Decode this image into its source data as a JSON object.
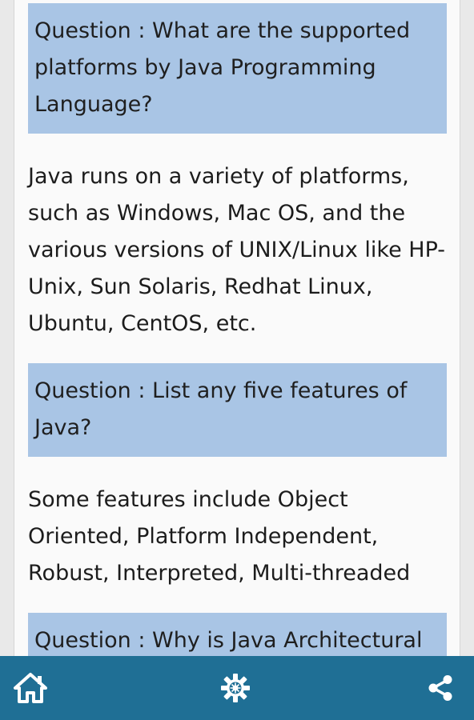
{
  "qa": [
    {
      "question": "Question : What are the supported platforms by Java Programming Language?",
      "answer": "Java runs on a variety of platforms, such as Windows, Mac OS, and the various versions of UNIX/Linux like HP-Unix, Sun Solaris, Redhat Linux, Ubuntu, CentOS, etc."
    },
    {
      "question": "Question : List any five features of Java?",
      "answer": "Some features include Object Oriented, Platform Independent, Robust, Interpreted, Multi-threaded"
    },
    {
      "question": "Question : Why is Java Architectural"
    }
  ],
  "bottom_bar": {
    "background": "#1f6f95",
    "icons": [
      "home-icon",
      "settings-gear-icon",
      "share-icon"
    ]
  },
  "colors": {
    "question_bg": "#a9c5e5",
    "page_bg": "#fafafa"
  }
}
